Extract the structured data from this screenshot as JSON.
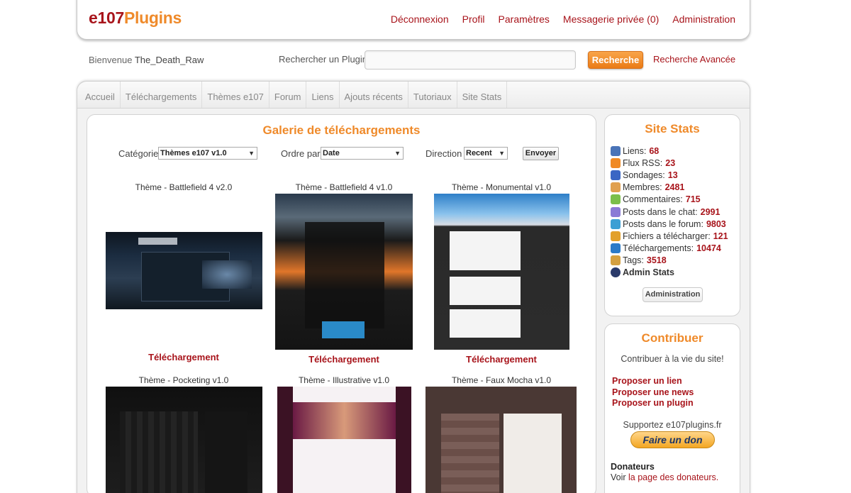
{
  "header": {
    "logo_part1": "e107",
    "logo_part2": "Plugins",
    "nav": [
      "Déconnexion",
      "Profil",
      "Paramètres",
      "Messagerie privée (0)",
      "Administration"
    ]
  },
  "subheader": {
    "welcome_prefix": "Bienvenue",
    "username": "The_Death_Raw",
    "search_label": "Rechercher un Plugin:",
    "search_value": "",
    "search_button": "Recherche",
    "advanced_search": "Recherche Avancée"
  },
  "menu": [
    "Accueil",
    "Téléchargements",
    "Thèmes e107",
    "Forum",
    "Liens",
    "Ajouts récents",
    "Tutoriaux",
    "Site Stats"
  ],
  "gallery": {
    "title": "Galerie de téléchargements",
    "category_label": "Catégorie",
    "category_value": "Thèmes e107 v1.0",
    "order_label": "Ordre par",
    "order_value": "Date",
    "direction_label": "Direction",
    "direction_value": "Recent",
    "send_button": "Envoyer",
    "download_label": "Téléchargement",
    "items": [
      {
        "name": "Thème - Battlefield 4 v2.0"
      },
      {
        "name": "Thème - Battlefield 4 v1.0"
      },
      {
        "name": "Thème - Monumental v1.0"
      },
      {
        "name": "Thème - Pocketing v1.0"
      },
      {
        "name": "Thème - Illustrative v1.0"
      },
      {
        "name": "Thème - Faux Mocha v1.0"
      }
    ]
  },
  "site_stats": {
    "title": "Site Stats",
    "rows": [
      {
        "label": "Liens:",
        "value": "68",
        "icon": "links-icon",
        "color": "#4a74b8"
      },
      {
        "label": "Flux RSS:",
        "value": "23",
        "icon": "rss-icon",
        "color": "#f08a24"
      },
      {
        "label": "Sondages:",
        "value": "13",
        "icon": "poll-icon",
        "color": "#3a66c4"
      },
      {
        "label": "Membres:",
        "value": "2481",
        "icon": "members-icon",
        "color": "#e0a050"
      },
      {
        "label": "Commentaires:",
        "value": "715",
        "icon": "comments-icon",
        "color": "#7bbf4a"
      },
      {
        "label": "Posts dans le chat:",
        "value": "2991",
        "icon": "chat-icon",
        "color": "#8a7ad6"
      },
      {
        "label": "Posts dans le forum:",
        "value": "9803",
        "icon": "forum-icon",
        "color": "#3c9fd4"
      },
      {
        "label": "Fichiers a télécharger:",
        "value": "121",
        "icon": "files-icon",
        "color": "#e2a02a"
      },
      {
        "label": "Téléchargements:",
        "value": "10474",
        "icon": "download-icon",
        "color": "#2a7ac8"
      },
      {
        "label": "Tags:",
        "value": "3518",
        "icon": "tags-icon",
        "color": "#d4a040"
      }
    ],
    "admin_stats": "Admin Stats",
    "admin_button": "Administration"
  },
  "contribuer": {
    "title": "Contribuer",
    "subtitle": "Contribuer à la vie du site!",
    "links": [
      "Proposer un lien",
      "Proposer une news",
      "Proposer un plugin"
    ],
    "support_text": "Supportez e107plugins.fr",
    "donate_button": "Faire un don",
    "donateurs_title": "Donateurs",
    "donateurs_prefix": "Voir",
    "donateurs_link": "la page des donateurs",
    "donateurs_suffix": "."
  }
}
